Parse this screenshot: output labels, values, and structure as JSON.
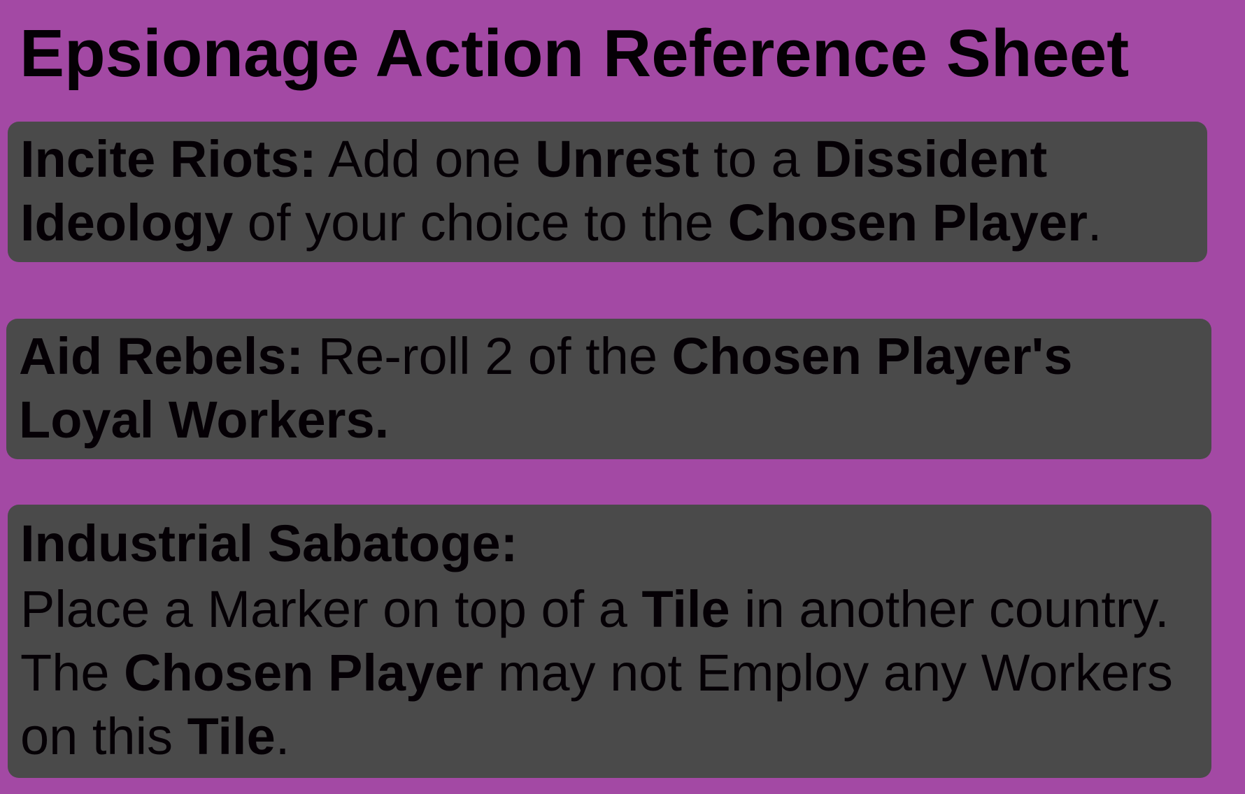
{
  "title": "Epsionage Action Reference Sheet",
  "actions": [
    {
      "name": "Incite Riots:",
      "t1": " Add one ",
      "b1": "Unrest",
      "t2": " to a ",
      "b2": "Dissident Ideology",
      "t3": " of your choice to the ",
      "b3": "Chosen Player",
      "t4": "."
    },
    {
      "name": "Aid Rebels:",
      "t1": " Re-roll 2 of the ",
      "b1": "Chosen Player's Loyal Workers."
    },
    {
      "name": "Industrial Sabatoge:",
      "t1": "Place a Marker on top of a ",
      "b1": "Tile",
      "t2": " in another country. The ",
      "b2": "Chosen Player",
      "t3": " may not Employ any Workers on this ",
      "b3": "Tile",
      "t4": "."
    }
  ]
}
